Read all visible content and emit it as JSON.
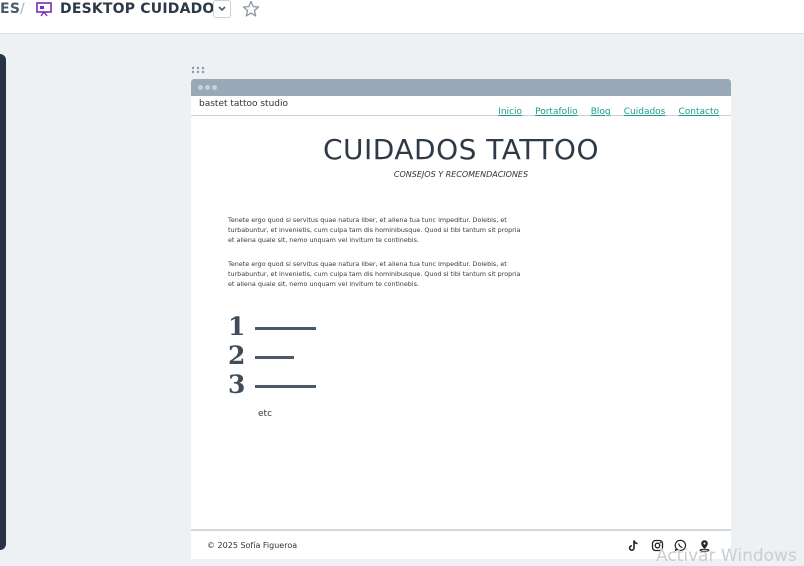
{
  "header": {
    "prev_crumb": "ES",
    "separator": "/",
    "page_icon": "presentation-board-icon",
    "page_title": "DESKTOP CUIDADOS",
    "dropdown_icon": "chevron-down-icon",
    "star_icon": "star-icon"
  },
  "site": {
    "brand": "bastet tattoo studio",
    "nav": [
      "Inicio",
      "Portafolio",
      "Blog",
      "Cuidados",
      "Contacto"
    ],
    "hero_title": "CUIDADOS TATTOO",
    "hero_subtitle": "CONSEJOS Y RECOMENDACIONES",
    "paragraphs": [
      "Tenete ergo quod si servitus quae natura liber, et aliena tua tunc impeditur. Dolebis, et turbabuntur, et invenietis, cum culpa tam dis hominibusque. Quod si tibi tantum sit propria et aliena quale sit, nemo unquam vel invitum te continebis.",
      "Tenete ergo quod si servitus quae natura liber, et aliena tua tunc impeditur. Dolebis, et turbabuntur, et invenietis, cum culpa tam dis hominibusque. Quod si tibi tantum sit propria et aliena quale sit, nemo unquam vel invitum te continebis."
    ],
    "list_numbers": [
      "1",
      "2",
      "3"
    ],
    "etc": "etc",
    "footer_copyright": "© 2025 Sofía Figueroa",
    "social_icons": [
      "tiktok-icon",
      "instagram-icon",
      "whatsapp-icon",
      "location-pin-icon"
    ],
    "accent_color": "#1a9c8a"
  },
  "os_watermark": "Activar Windows"
}
